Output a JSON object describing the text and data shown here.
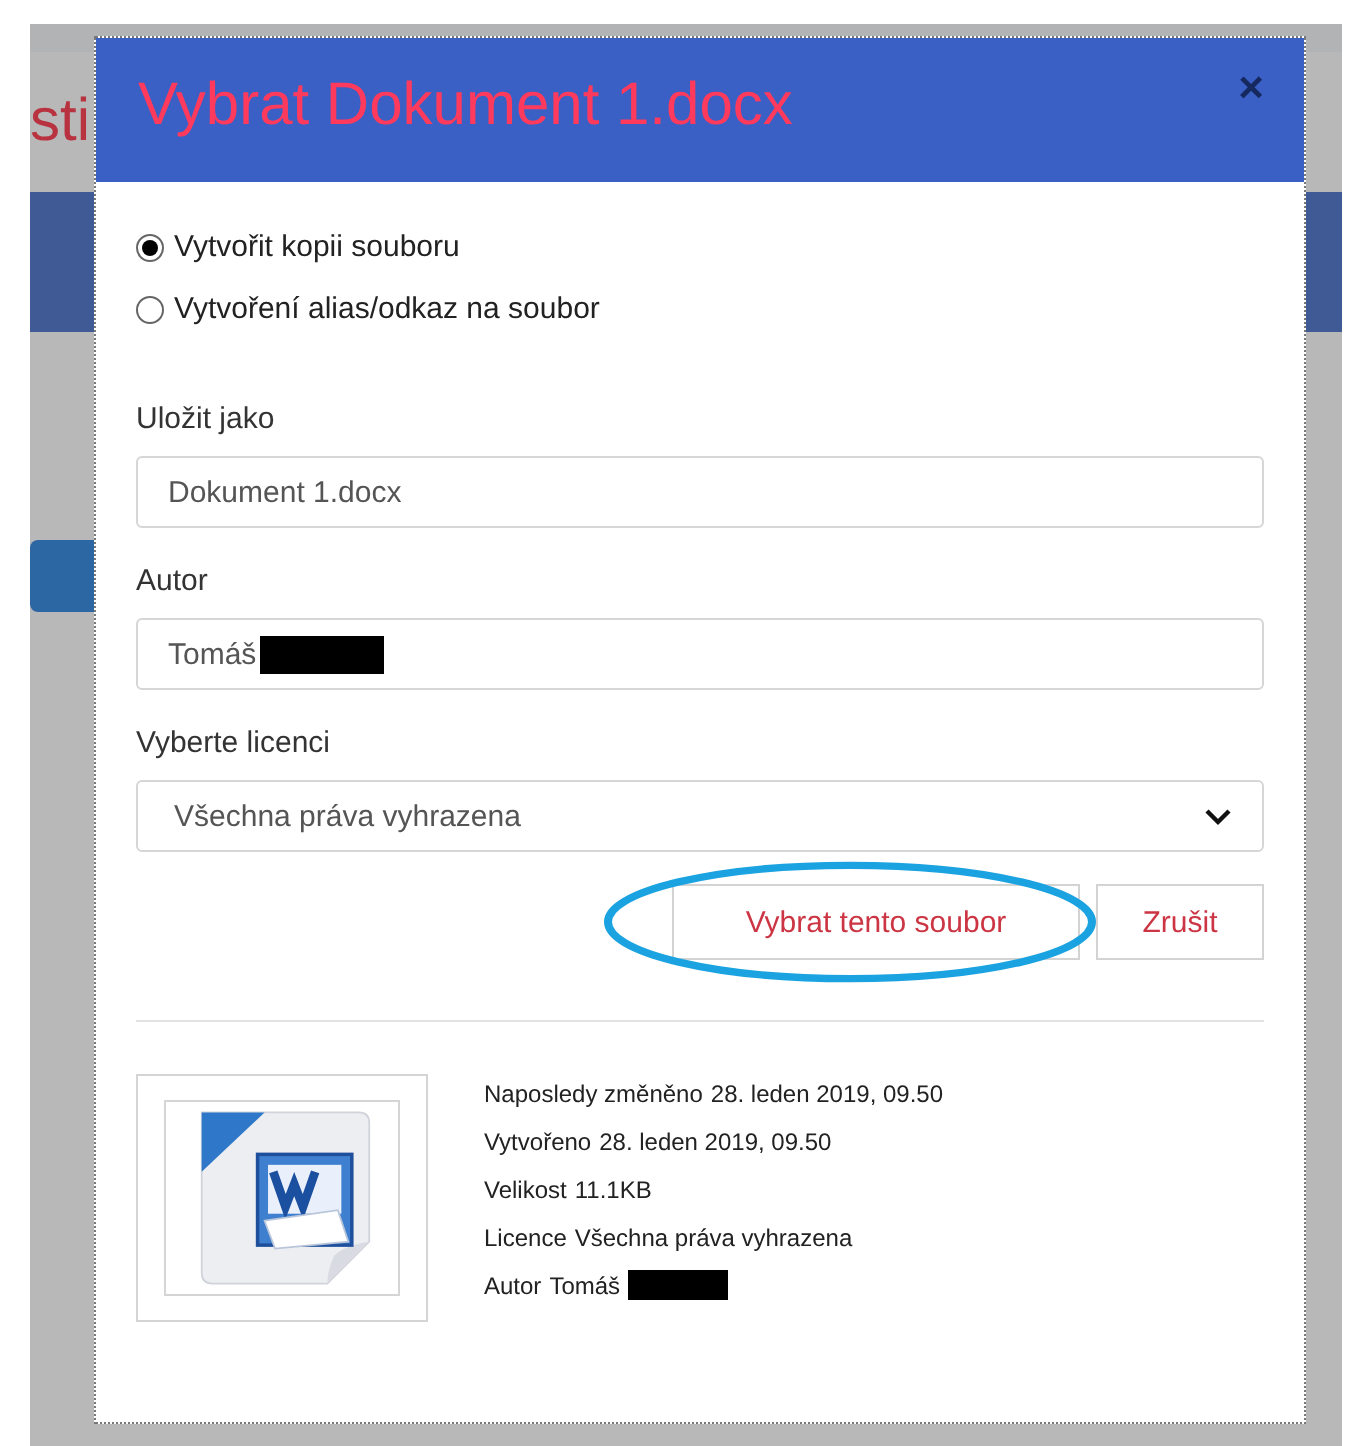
{
  "background": {
    "heading_fragment": "sti"
  },
  "dialog": {
    "title": "Vybrat Dokument 1.docx",
    "close": "×",
    "options": [
      {
        "label": "Vytvořit kopii souboru",
        "selected": true
      },
      {
        "label": "Vytvoření alias/odkaz na soubor",
        "selected": false
      }
    ],
    "fields": [
      {
        "label": "Uložit jako",
        "kind": "text",
        "value": "Dokument 1.docx",
        "redacted": false
      },
      {
        "label": "Autor",
        "kind": "text",
        "value": "Tomáš",
        "redacted": true
      },
      {
        "label": "Vyberte licenci",
        "kind": "select",
        "value": "Všechna práva vyhrazena",
        "redacted": false
      }
    ],
    "buttons": [
      {
        "label": "Vybrat tento soubor",
        "highlighted": true
      },
      {
        "label": "Zrušit",
        "highlighted": false
      }
    ],
    "file_info": [
      {
        "label": "Naposledy změněno",
        "value": "28. leden 2019, 09.50",
        "redacted": false
      },
      {
        "label": "Vytvořeno",
        "value": "28. leden 2019, 09.50",
        "redacted": false
      },
      {
        "label": "Velikost",
        "value": "11.1KB",
        "redacted": false
      },
      {
        "label": "Licence",
        "value": "Všechna práva vyhrazena",
        "redacted": false
      },
      {
        "label": "Autor",
        "value": "Tomáš",
        "redacted": true
      }
    ]
  }
}
